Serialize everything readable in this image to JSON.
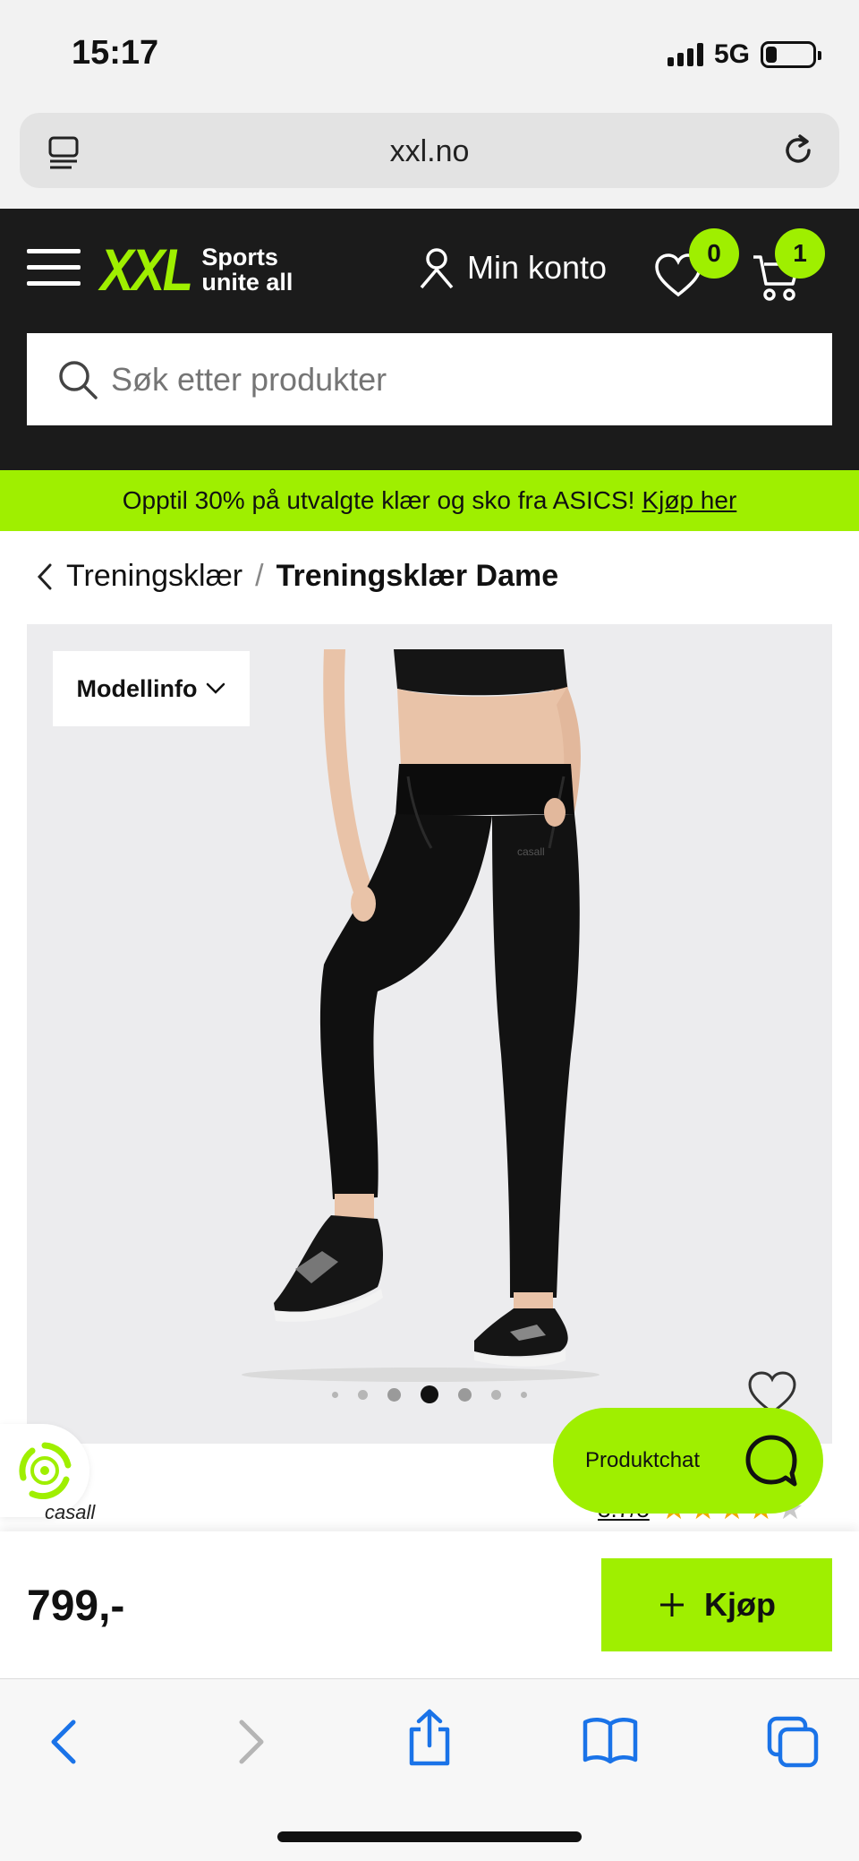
{
  "status": {
    "time": "15:17",
    "network": "5G"
  },
  "browser": {
    "url": "xxl.no"
  },
  "header": {
    "logo_main": "XXL",
    "logo_tag_line1": "Sports",
    "logo_tag_line2": "unite all",
    "account_label": "Min konto",
    "wishlist_count": "0",
    "cart_count": "1",
    "search_placeholder": "Søk etter produkter",
    "accent_color": "#9fef00"
  },
  "promo": {
    "text": "Opptil 30% på utvalgte klær og sko fra ASICS!",
    "link": "Kjøp her"
  },
  "breadcrumb": {
    "parent": "Treningsklær",
    "separator": "/",
    "current": "Treningsklær Dame"
  },
  "gallery": {
    "model_info_label": "Modellinfo",
    "image_count": 7,
    "active_index": 3,
    "image_logo": "casall"
  },
  "chat": {
    "label": "Produktchat"
  },
  "product": {
    "brand": "casall",
    "rating_text": "3.7/5",
    "stars_filled": 4,
    "stars_total": 5,
    "price": "799,-"
  },
  "buy": {
    "label": "Kjøp"
  }
}
